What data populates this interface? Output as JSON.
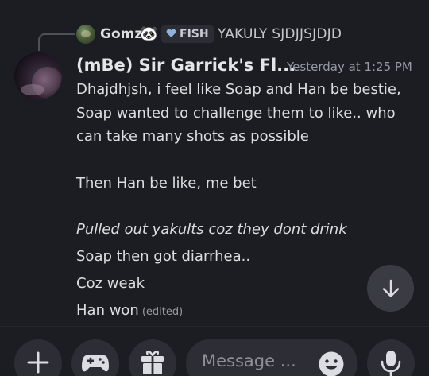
{
  "reply_reference": {
    "author": "Gomz",
    "author_badge_emoji": "🐼",
    "tag_icon": "heart-icon",
    "tag_label": "FISH",
    "preview_text": "YAKULY SJDJJSJDJD"
  },
  "message": {
    "author": "(mBe) Sir Garrick's Fl...",
    "timestamp": "Yesterday at 1:25 PM",
    "paragraph_1": [
      "Dhajdhjsh, i feel like Soap and Han be bestie,",
      "Soap wanted to challenge them to like.. who",
      "can take many shots as possible"
    ],
    "paragraph_2": "Then Han be like, me bet",
    "italic_line": "Pulled out yakults coz they dont drink",
    "line_soap": "Soap then got diarrhea..",
    "line_weak": "Coz weak",
    "line_han": "Han won",
    "edited_label": "(edited)"
  },
  "jump_button": {
    "icon": "arrow-down-icon"
  },
  "composer": {
    "add_icon": "plus-icon",
    "games_icon": "gamepad-icon",
    "gift_icon": "gift-icon",
    "placeholder": "Message ...",
    "emoji_icon": "smiley-icon",
    "mic_icon": "microphone-icon"
  },
  "colors": {
    "background": "#1c1d22",
    "button_bg": "#2d2e35",
    "text_primary": "#dbdee1",
    "text_muted": "#949ba4"
  }
}
